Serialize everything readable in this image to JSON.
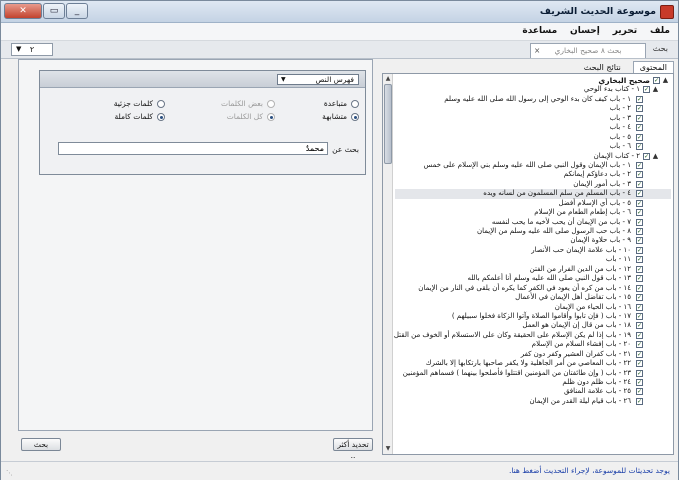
{
  "window": {
    "title": "موسوعة الحديث الشريف"
  },
  "menu": [
    "ملف",
    "تحرير",
    "إحسان",
    "مساعدة"
  ],
  "tabs": {
    "search_label": "بحث",
    "document_tab": "بحث ٨ صحيح البخاري",
    "page_selector": "٢"
  },
  "right_panel": {
    "tabs": [
      {
        "label": "المحتوى",
        "active": true
      },
      {
        "label": "نتائج البحث",
        "active": false
      }
    ],
    "tree": [
      {
        "level": 0,
        "label": "صحيح البخاري",
        "expander": "▲"
      },
      {
        "level": 1,
        "label": "١ - كتاب بدء الوحي",
        "expander": "▲"
      },
      {
        "level": 2,
        "label": "١ - باب كيف كان بدء الوحي إلى رسول الله صلى الله عليه وسلم"
      },
      {
        "level": 2,
        "label": "٢ - باب"
      },
      {
        "level": 2,
        "label": "٣ - باب"
      },
      {
        "level": 2,
        "label": "٤ - باب"
      },
      {
        "level": 2,
        "label": "٥ - باب"
      },
      {
        "level": 2,
        "label": "٦ - باب"
      },
      {
        "level": 1,
        "label": "٢ - كتاب الإيمان",
        "expander": "▲"
      },
      {
        "level": 2,
        "label": "١ - باب الإيمان وقول النبي صلى الله عليه وسلم بني الإسلام على خمس"
      },
      {
        "level": 2,
        "label": "٢ - باب دعاؤكم إيمانكم"
      },
      {
        "level": 2,
        "label": "٣ - باب أمور الإيمان"
      },
      {
        "level": 2,
        "label": "٤ - باب المسلم من سلم المسلمون من لسانه ويده",
        "highlight": true
      },
      {
        "level": 2,
        "label": "٥ - باب أي الإسلام أفضل"
      },
      {
        "level": 2,
        "label": "٦ - باب إطعام الطعام من الإسلام"
      },
      {
        "level": 2,
        "label": "٧ - باب من الإيمان أن يحب لأخيه ما يحب لنفسه"
      },
      {
        "level": 2,
        "label": "٨ - باب حب الرسول صلى الله عليه وسلم من الإيمان"
      },
      {
        "level": 2,
        "label": "٩ - باب حلاوة الإيمان"
      },
      {
        "level": 2,
        "label": "١٠ - باب علامة الإيمان حب الأنصار"
      },
      {
        "level": 2,
        "label": "١١ - باب"
      },
      {
        "level": 2,
        "label": "١٢ - باب من الدين الفرار من الفتن"
      },
      {
        "level": 2,
        "label": "١٣ - باب قول النبي صلى الله عليه وسلم أنا أعلمكم بالله"
      },
      {
        "level": 2,
        "label": "١٤ - باب من كره أن يعود في الكفر كما يكره أن يلقى في النار من الإيمان"
      },
      {
        "level": 2,
        "label": "١٥ - باب تفاضل أهل الإيمان في الأعمال"
      },
      {
        "level": 2,
        "label": "١٦ - باب الحياء من الإيمان"
      },
      {
        "level": 2,
        "label": "١٧ - باب ( فإن تابوا وأقاموا الصلاة وآتوا الزكاة فخلوا سبيلهم )"
      },
      {
        "level": 2,
        "label": "١٨ - باب من قال إن الإيمان هو العمل"
      },
      {
        "level": 2,
        "label": "١٩ - باب إذا لم يكن الإسلام على الحقيقة وكان على الاستسلام أو الخوف من القتل"
      },
      {
        "level": 2,
        "label": "٢٠ - باب إفشاء السلام من الإسلام"
      },
      {
        "level": 2,
        "label": "٢١ - باب كفران العشير وكفر دون كفر"
      },
      {
        "level": 2,
        "label": "٢٢ - باب المعاصي من أمر الجاهلية ولا يكفر صاحبها بارتكابها إلا بالشرك"
      },
      {
        "level": 2,
        "label": "٢٣ - باب ( وإن طائفتان من المؤمنين اقتتلوا فأصلحوا بينهما ) فسماهم المؤمنين"
      },
      {
        "level": 2,
        "label": "٢٤ - باب ظلم دون ظلم"
      },
      {
        "level": 2,
        "label": "٢٥ - باب علامة المنافق"
      },
      {
        "level": 2,
        "label": "٢٦ - باب قيام ليلة القدر من الإيمان"
      }
    ]
  },
  "left_panel": {
    "index_dropdown": "فهرس النص",
    "radios": [
      {
        "label": "متشابهة",
        "checked": true,
        "enabled": true,
        "col": 0,
        "row": 1
      },
      {
        "label": "متباعدة",
        "checked": false,
        "enabled": true,
        "col": 0,
        "row": 0
      },
      {
        "label": "كل الكلمات",
        "checked": true,
        "enabled": false,
        "col": 1,
        "row": 1
      },
      {
        "label": "بعض الكلمات",
        "checked": false,
        "enabled": false,
        "col": 1,
        "row": 0
      },
      {
        "label": "كلمات كاملة",
        "checked": true,
        "enabled": true,
        "col": 2,
        "row": 1
      },
      {
        "label": "كلمات جزئية",
        "checked": false,
        "enabled": true,
        "col": 2,
        "row": 0
      }
    ],
    "search_label": "بحث عن",
    "search_value": "محمدٌ",
    "refine_button": "تحديد أكثر ..",
    "search_button": "بحث"
  },
  "status": {
    "message": "يوجد تحديثات للموسوعة، لإجراء التحديث أضغط هنا."
  }
}
